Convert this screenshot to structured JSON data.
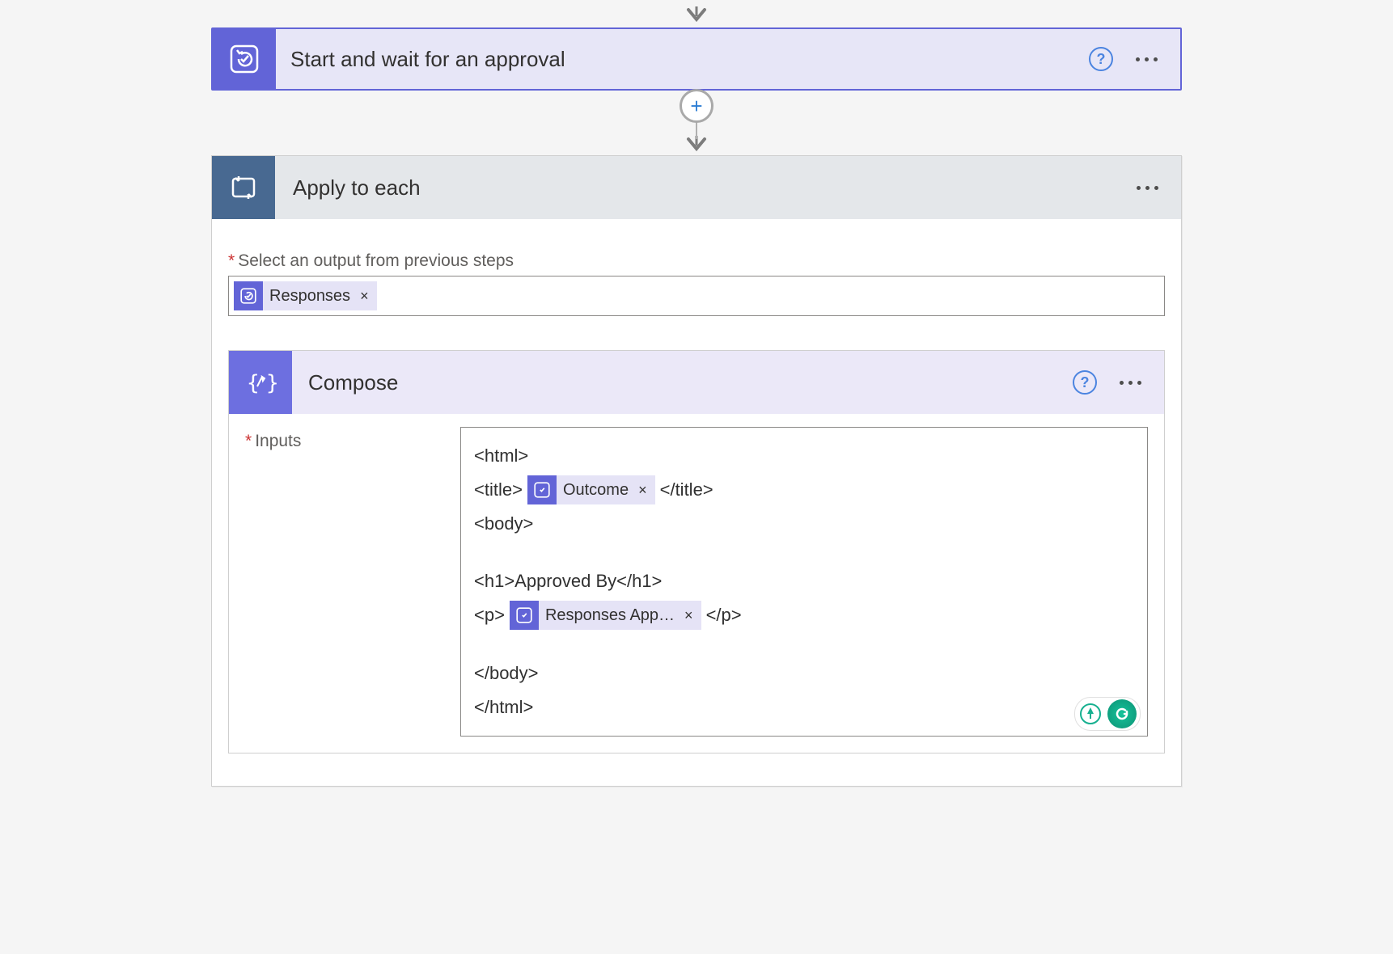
{
  "approval_card": {
    "title": "Start and wait for an approval"
  },
  "apply_each": {
    "title": "Apply to each",
    "select_label": "Select an output from previous steps",
    "token": {
      "label": "Responses"
    }
  },
  "compose": {
    "title": "Compose",
    "inputs_label": "Inputs",
    "content": {
      "html_open": "<html>",
      "title_open": "<title>",
      "title_close": "</title>",
      "body_open": "<body>",
      "h1": "<h1>Approved By</h1>",
      "p_open": "<p>",
      "p_close": "</p>",
      "body_close": "</body>",
      "html_close": "</html>",
      "token_outcome": "Outcome",
      "token_responses_app": "Responses App…"
    }
  },
  "icons": {
    "help": "?",
    "plus": "+",
    "x": "×"
  }
}
